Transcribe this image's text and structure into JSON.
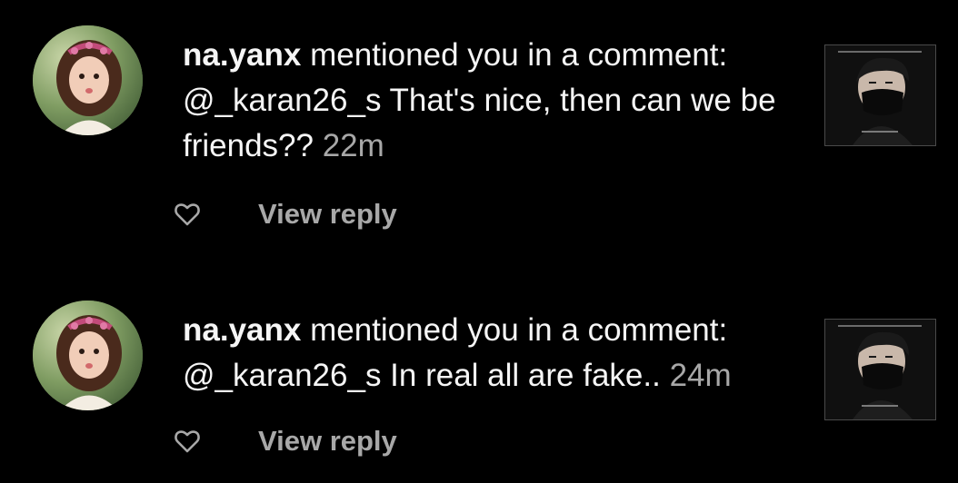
{
  "notifications": [
    {
      "username": "na.yanx",
      "action": " mentioned you in a comment:",
      "mention": "@_karan26_s",
      "comment": " That's nice, then can we be friends??",
      "time": " 22m",
      "reply_label": "View reply",
      "avatar_icon": "profile-photo-girl",
      "thumb_icon": "post-thumbnail-masked-person"
    },
    {
      "username": "na.yanx",
      "action": " mentioned you in a comment:",
      "mention": "@_karan26_s",
      "comment": " In real all are fake..",
      "time": " 24m",
      "reply_label": "View reply",
      "avatar_icon": "profile-photo-girl",
      "thumb_icon": "post-thumbnail-masked-person"
    }
  ],
  "colors": {
    "background": "#000000",
    "text": "#f5f5f5",
    "secondary": "#a8a8a8"
  }
}
